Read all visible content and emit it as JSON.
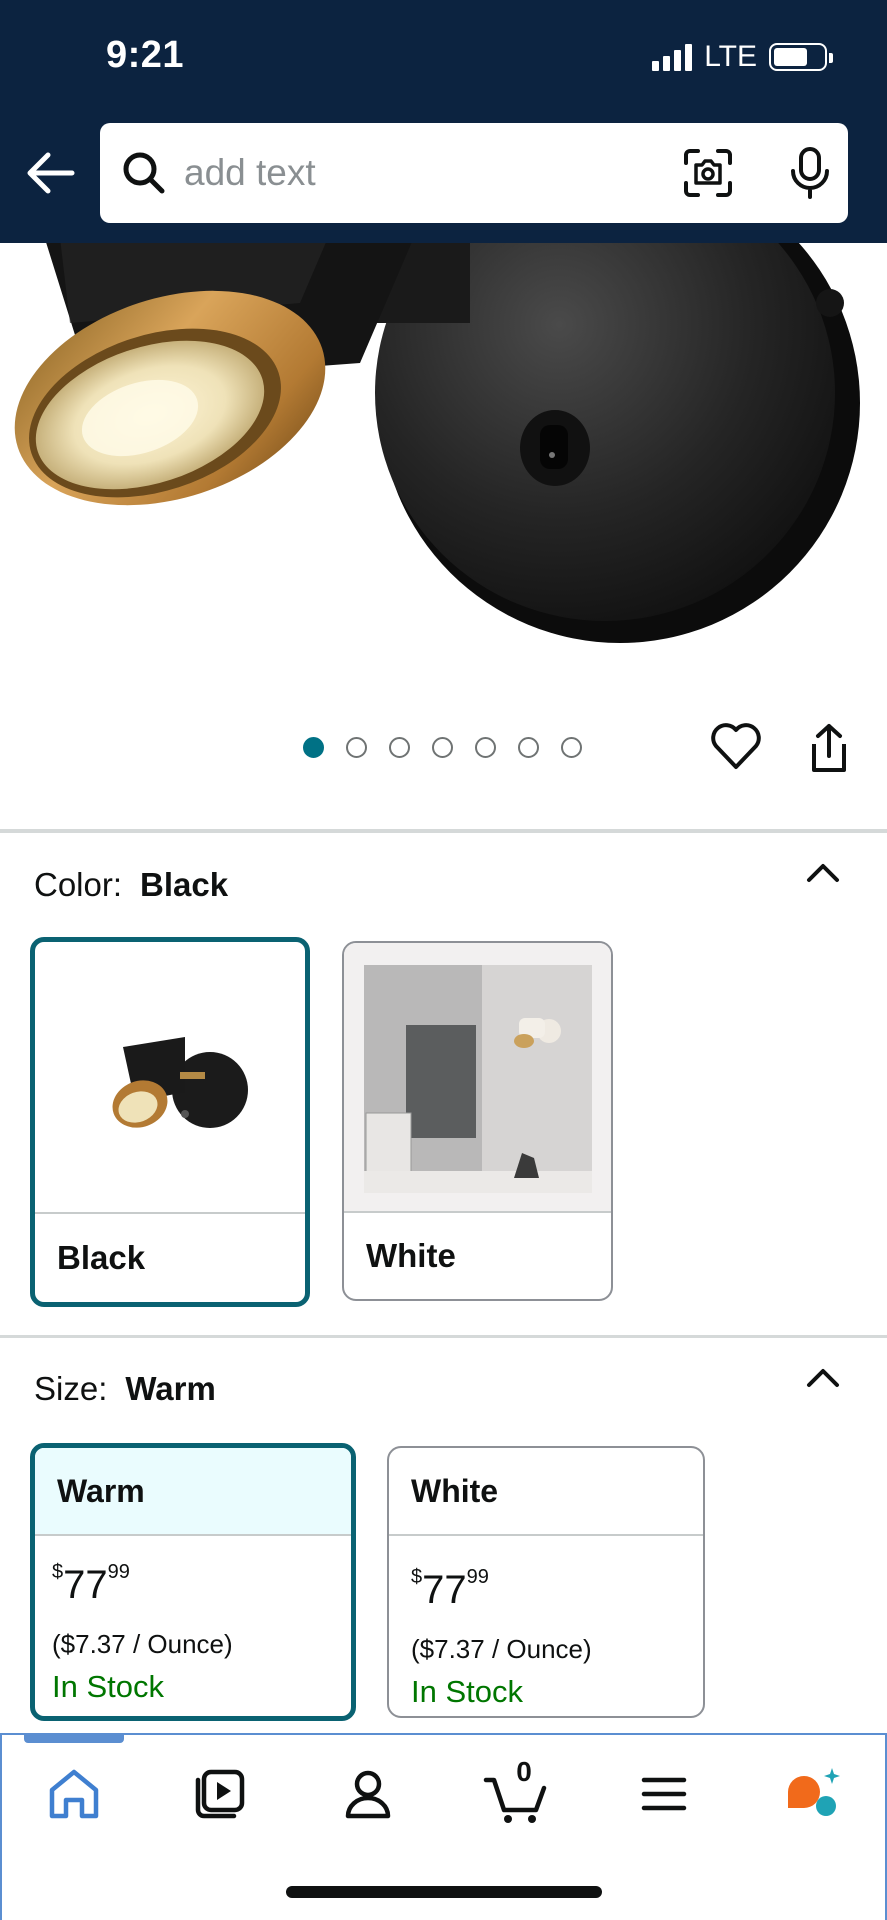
{
  "status_bar": {
    "time": "9:21",
    "network": "LTE"
  },
  "search": {
    "placeholder": "add text"
  },
  "carousel": {
    "total": 7,
    "active_index": 0
  },
  "color": {
    "label": "Color:",
    "selected": "Black",
    "options": [
      {
        "name": "Black",
        "selected": true
      },
      {
        "name": "White",
        "selected": false
      }
    ]
  },
  "size": {
    "label": "Size:",
    "selected": "Warm",
    "options": [
      {
        "name": "Warm",
        "currency": "$",
        "price_whole": "77",
        "price_fraction": "99",
        "unit_price": "($7.37 / Ounce)",
        "stock": "In Stock",
        "selected": true
      },
      {
        "name": "White",
        "currency": "$",
        "price_whole": "77",
        "price_fraction": "99",
        "unit_price": "($7.37 / Ounce)",
        "stock": "In Stock",
        "selected": false
      }
    ]
  },
  "bottom_nav": {
    "items": [
      "home-icon",
      "video-icon",
      "profile-icon",
      "cart-icon",
      "menu-icon",
      "assistant-icon"
    ],
    "cart_count": "0"
  },
  "colors": {
    "header_bg": "#0c2340",
    "accent_teal": "#007185",
    "selected_border": "#0a6272",
    "in_stock": "#007600",
    "nav_accent": "#5b8ed1"
  }
}
